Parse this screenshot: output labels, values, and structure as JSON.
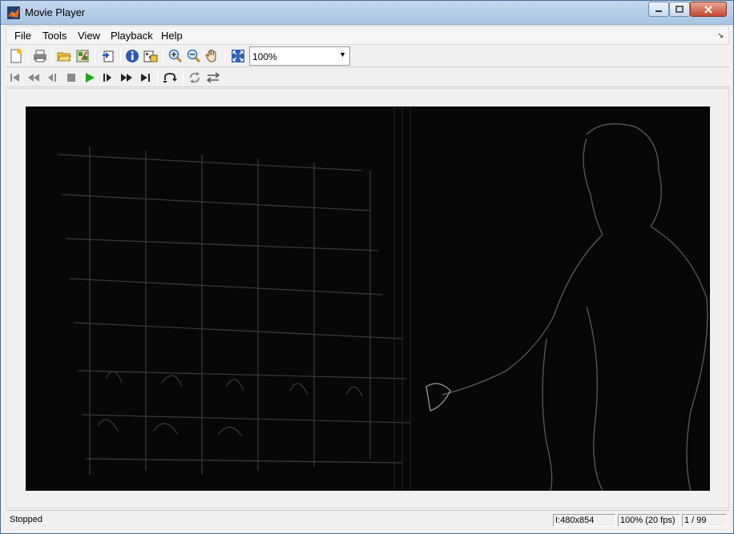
{
  "window": {
    "title": "Movie Player"
  },
  "menu": [
    {
      "label": "File"
    },
    {
      "label": "Tools"
    },
    {
      "label": "View"
    },
    {
      "label": "Playback"
    },
    {
      "label": "Help"
    }
  ],
  "toolbar": {
    "zoom": "100%",
    "icons": [
      "new-document-icon",
      "print-icon",
      "open-folder-icon",
      "import-icon",
      "export-frame-icon",
      "info-icon",
      "colormap-icon",
      "zoom-in-icon",
      "zoom-out-icon",
      "pan-hand-icon",
      "fit-to-window-icon"
    ]
  },
  "playback": {
    "icons": [
      "first-frame-icon",
      "rewind-icon",
      "step-back-icon",
      "stop-icon",
      "play-icon",
      "step-forward-icon",
      "fast-forward-icon",
      "last-frame-icon",
      "jump-to-icon",
      "loop-icon",
      "palindrome-icon"
    ],
    "play_color": "#1aa51a"
  },
  "status": {
    "state": "Stopped",
    "frame_size": "I:480x854",
    "rate": "100% (20 fps)",
    "frame": "1 / 99"
  }
}
